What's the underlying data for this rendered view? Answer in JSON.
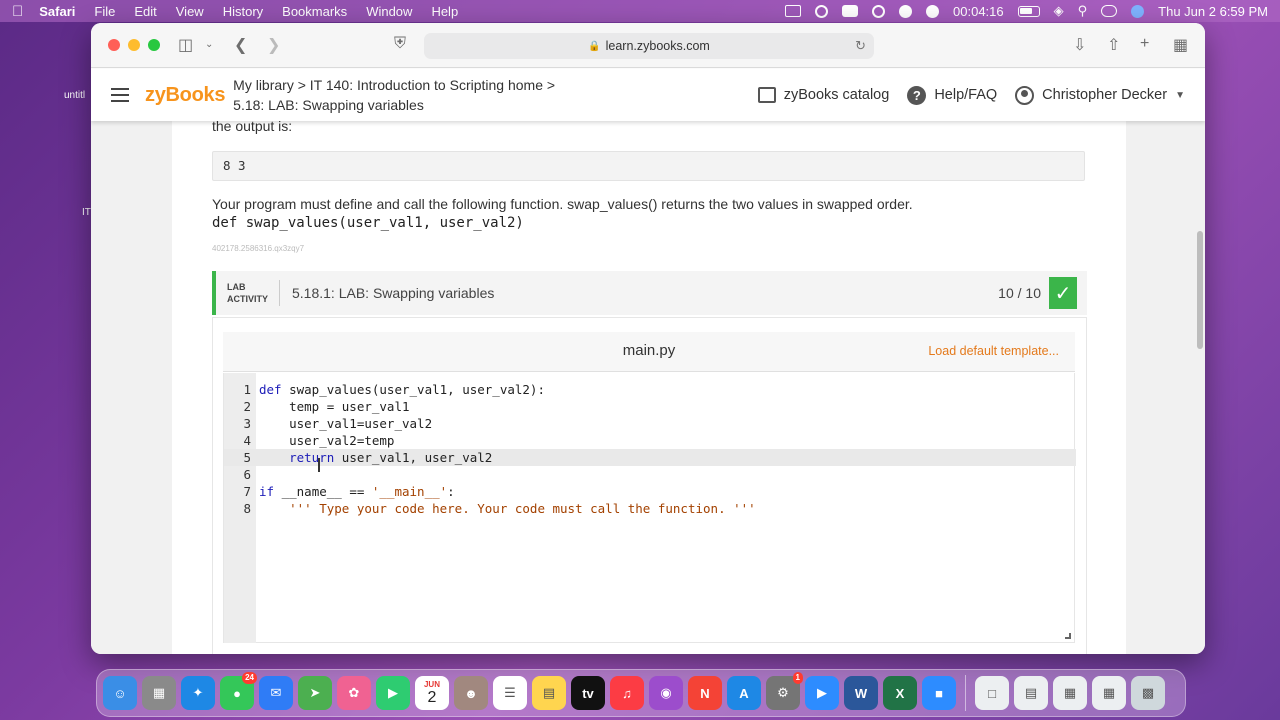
{
  "menubar": {
    "app": "Safari",
    "items": [
      "File",
      "Edit",
      "View",
      "History",
      "Bookmarks",
      "Window",
      "Help"
    ],
    "recording_time": "00:04:16",
    "datetime": "Thu Jun 2  6:59 PM"
  },
  "desktop": {
    "label_1": "untitl",
    "label_2": "IT"
  },
  "browser": {
    "url": "learn.zybooks.com"
  },
  "header": {
    "logo": "zyBooks",
    "breadcrumb_line1": "My library > IT 140: Introduction to Scripting home >",
    "breadcrumb_line2": "5.18: LAB: Swapping variables",
    "catalog": "zyBooks catalog",
    "help": "Help/FAQ",
    "user": "Christopher Decker"
  },
  "content": {
    "output_intro": "the output is:",
    "output_value": "8 3",
    "description": "Your program must define and call the following function. swap_values() returns the two values in swapped order.",
    "signature": "def swap_values(user_val1, user_val2)",
    "section_id": "402178.2586316.qx3zqy7"
  },
  "lab": {
    "tag_line1": "LAB",
    "tag_line2": "ACTIVITY",
    "title": "5.18.1: LAB: Swapping variables",
    "score": "10 / 10"
  },
  "editor": {
    "file_name": "main.py",
    "load_template": "Load default template...",
    "lines": [
      {
        "n": "1",
        "text": "def swap_values(user_val1, user_val2):"
      },
      {
        "n": "2",
        "text": "    temp = user_val1"
      },
      {
        "n": "3",
        "text": "    user_val1=user_val2"
      },
      {
        "n": "4",
        "text": "    user_val2=temp"
      },
      {
        "n": "5",
        "text": "    return user_val1, user_val2"
      },
      {
        "n": "6",
        "text": ""
      },
      {
        "n": "7",
        "text": "if __name__ == '__main__':"
      },
      {
        "n": "8",
        "text": "    ''' Type your code here. Your code must call the function. '''"
      }
    ]
  },
  "dock": {
    "messages_badge": "24",
    "calendar_month": "JUN",
    "calendar_day": "2",
    "settings_badge": "1"
  },
  "colors": {
    "accent_orange": "#f7941d",
    "success_green": "#3bb54a",
    "link_orange": "#e47a1c",
    "keyword_blue": "#1d1db8",
    "string_brown": "#a34100"
  }
}
